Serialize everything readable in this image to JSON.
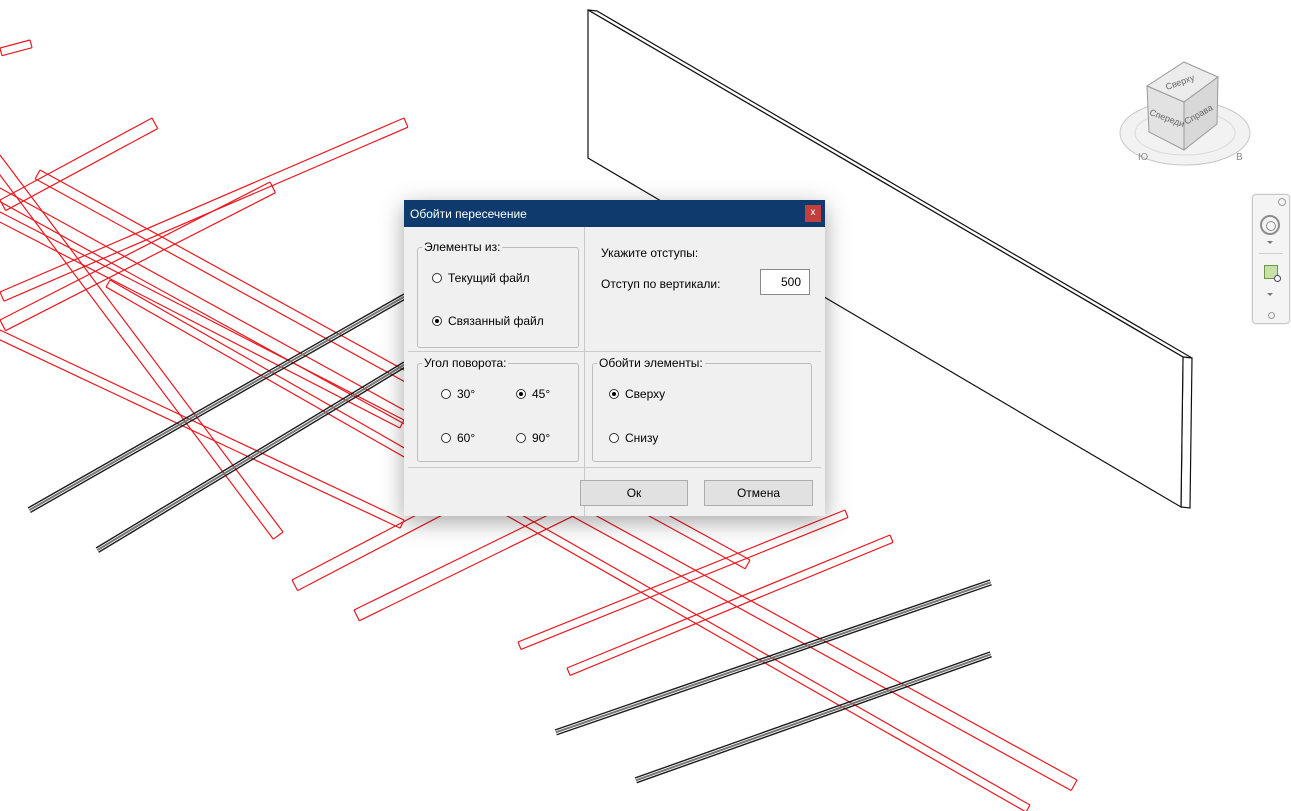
{
  "dialog": {
    "title": "Обойти пересечение",
    "close_label": "x",
    "source_group": {
      "legend": "Элементы из:",
      "options": [
        "Текущий файл",
        "Связанный файл"
      ],
      "selected": "Связанный файл"
    },
    "offsets": {
      "heading": "Укажите отступы:",
      "vertical_label": "Отступ по вертикали:",
      "vertical_value": "500"
    },
    "angle_group": {
      "legend": "Угол поворота:",
      "options": [
        "30°",
        "45°",
        "60°",
        "90°"
      ],
      "selected": "45°"
    },
    "bypass_group": {
      "legend": "Обойти элементы:",
      "options": [
        "Сверху",
        "Снизу"
      ],
      "selected": "Сверху"
    },
    "ok_label": "Ок",
    "cancel_label": "Отмена"
  },
  "viewcube": {
    "faces": [
      "Сверху",
      "Спереди",
      "Справа"
    ],
    "compass": [
      "Ю",
      "В"
    ]
  },
  "colors": {
    "titlebar": "#0f3a6e",
    "close": "#c43e3e",
    "model_lines": "#e8181f",
    "profiles": "#1a1a1a"
  }
}
